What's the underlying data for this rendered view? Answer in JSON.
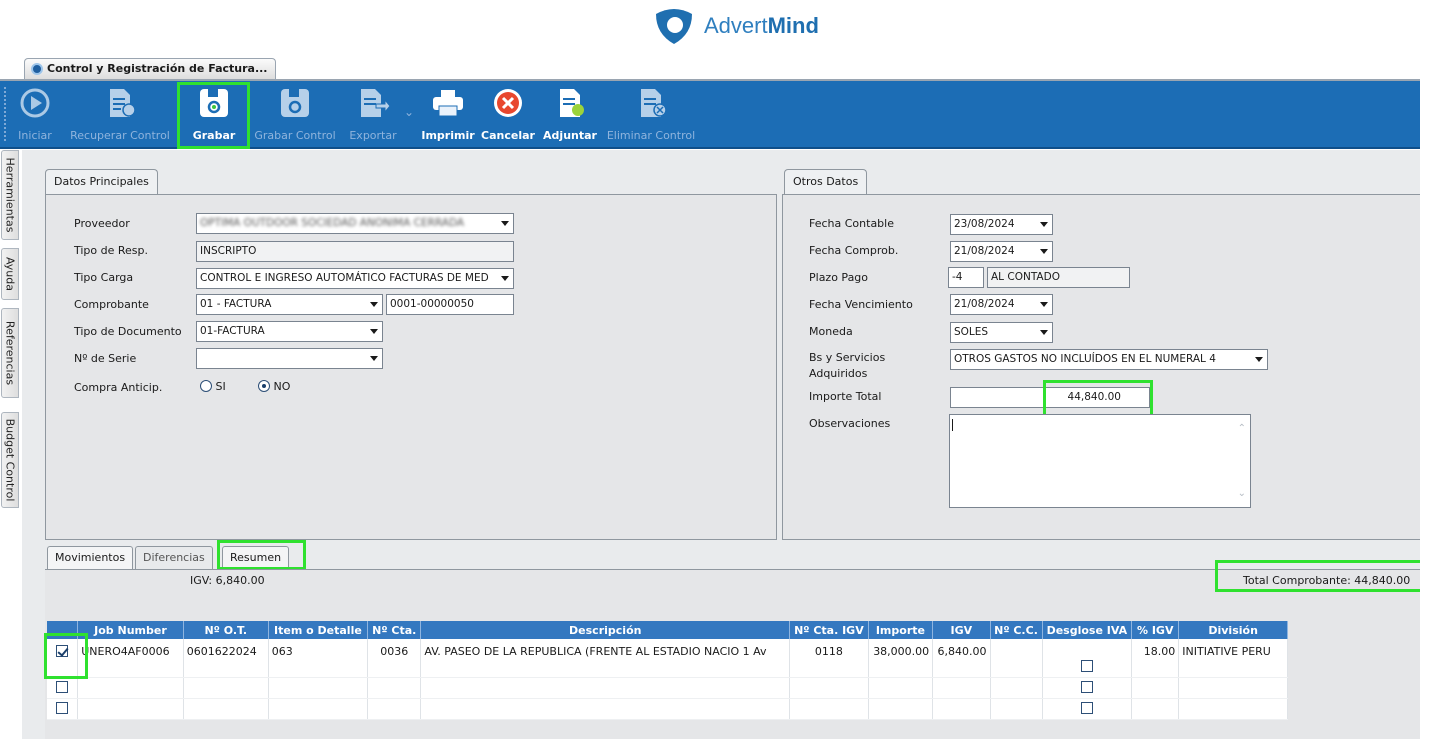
{
  "brand": {
    "name_light": "Advert",
    "name_bold": "Mind"
  },
  "window": {
    "tab_title": "Control y Registración de Factura..."
  },
  "toolbar": {
    "iniciar": "Iniciar",
    "recuperar_control": "Recuperar Control",
    "grabar": "Grabar",
    "grabar_control": "Grabar Control",
    "exportar": "Exportar",
    "imprimir": "Imprimir",
    "cancelar": "Cancelar",
    "adjuntar": "Adjuntar",
    "eliminar_control": "Eliminar Control"
  },
  "side_tabs": [
    "Herramientas",
    "Ayuda",
    "Referencias",
    "Budget Control"
  ],
  "datos_principales": {
    "tab": "Datos Principales",
    "proveedor_label": "Proveedor",
    "proveedor_value": "OPTIMA OUTDOOR SOCIEDAD ANONIMA CERRADA",
    "tipo_resp_label": "Tipo de Resp.",
    "tipo_resp_value": "INSCRIPTO",
    "tipo_carga_label": "Tipo Carga",
    "tipo_carga_value": "CONTROL E INGRESO AUTOMÁTICO FACTURAS DE MED",
    "comprobante_label": "Comprobante",
    "comprobante_value": "01 - FACTURA",
    "comprobante_numero": "0001-00000050",
    "tipo_documento_label": "Tipo de Documento",
    "tipo_documento_value": "01-FACTURA",
    "serie_label": "Nº de Serie",
    "serie_value": "",
    "compra_anticip_label": "Compra Anticip.",
    "opt_si": "SI",
    "opt_no": "NO"
  },
  "otros_datos": {
    "tab": "Otros Datos",
    "fecha_contable_label": "Fecha Contable",
    "fecha_contable_value": "23/08/2024",
    "fecha_comprob_label": "Fecha Comprob.",
    "fecha_comprob_value": "21/08/2024",
    "plazo_pago_label": "Plazo Pago",
    "plazo_pago_dias": "-4",
    "plazo_pago_desc": "AL CONTADO",
    "fecha_venc_label": "Fecha Vencimiento",
    "fecha_venc_value": "21/08/2024",
    "moneda_label": "Moneda",
    "moneda_value": "SOLES",
    "bs_servicios_label_1": "Bs y Servicios",
    "bs_servicios_label_2": "Adquiridos",
    "bs_servicios_value": "OTROS GASTOS NO INCLUÍDOS EN EL NUMERAL 4",
    "importe_total_label": "Importe Total",
    "importe_total_value": "44,840.00",
    "observaciones_label": "Observaciones",
    "observaciones_value": ""
  },
  "lower_tabs": {
    "movimientos": "Movimientos",
    "diferencias": "Diferencias",
    "resumen": "Resumen"
  },
  "summary": {
    "igv": "IGV: 6,840.00",
    "total_comprobante": "Total Comprobante: 44,840.00"
  },
  "grid": {
    "headers": [
      "",
      "Job Number",
      "Nº O.T.",
      "Item o Detalle",
      "Nº Cta.",
      "Descripción",
      "Nº Cta. IGV",
      "Importe",
      "IGV",
      "Nº C.C.",
      "Desglose IVA",
      "% IGV",
      "División"
    ],
    "row1": {
      "job_number": "UNERO4AF0006",
      "ot": "0601622024",
      "item": "063",
      "cta": "0036",
      "descripcion": "AV. PASEO DE LA REPUBLICA (FRENTE AL ESTADIO NACIO 1 Av",
      "cta_igv": "0118",
      "importe": "38,000.00",
      "igv": "6,840.00",
      "cc": "",
      "pct_igv": "18.00",
      "division": "INITIATIVE PERU"
    }
  },
  "colors": {
    "toolbar": "#1c6db5",
    "grid_header": "#3478c0",
    "highlight": "#2fe12f",
    "brand": "#2f7fbf"
  }
}
